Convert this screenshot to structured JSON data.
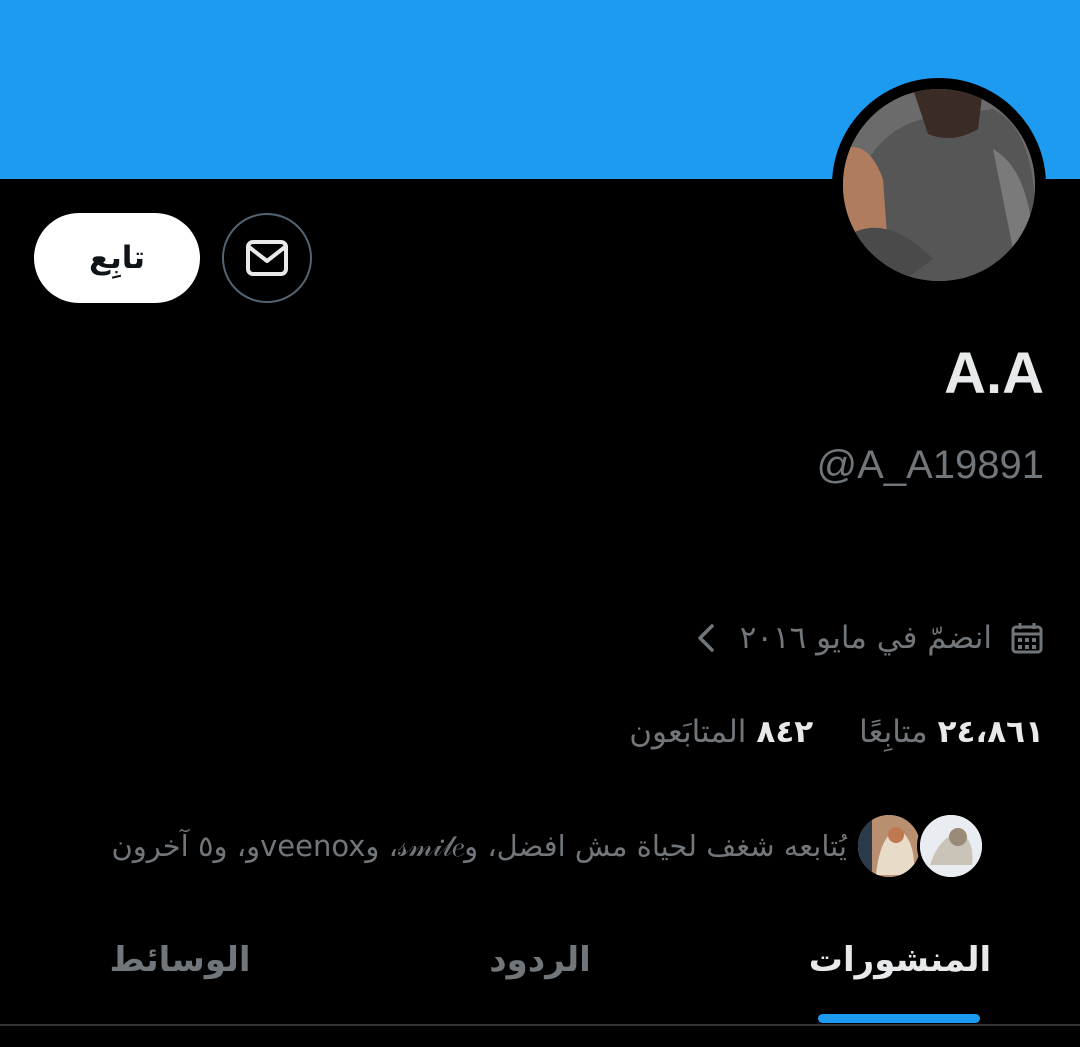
{
  "colors": {
    "banner": "#1d9bf0",
    "accent": "#1d9bf0",
    "background": "#000000",
    "primary_text": "#e7e9ea",
    "secondary_text": "#71767b"
  },
  "profile": {
    "display_name": "A.A",
    "handle": "@A_A19891",
    "joined": "انضمّ في مايو ٢٠١٦",
    "joined_icon": "calendar-icon",
    "expand_icon": "chevron-left-icon",
    "followers_count": "٨٤٢",
    "followers_label": "المتابَعون",
    "following_count": "٢٤،٨٦١",
    "following_label": "متابِعًا",
    "followed_by_text": "يُتابعه شغف لحياة مش افضل، و𝓈𝓂𝒾𝓁𝑒، وveenoxو، و٥ آخرون"
  },
  "actions": {
    "follow_label": "تابِع",
    "message_icon": "envelope-icon"
  },
  "tabs": [
    {
      "label": "المنشورات",
      "active": true
    },
    {
      "label": "الردود",
      "active": false
    },
    {
      "label": "الوسائط",
      "active": false
    }
  ]
}
